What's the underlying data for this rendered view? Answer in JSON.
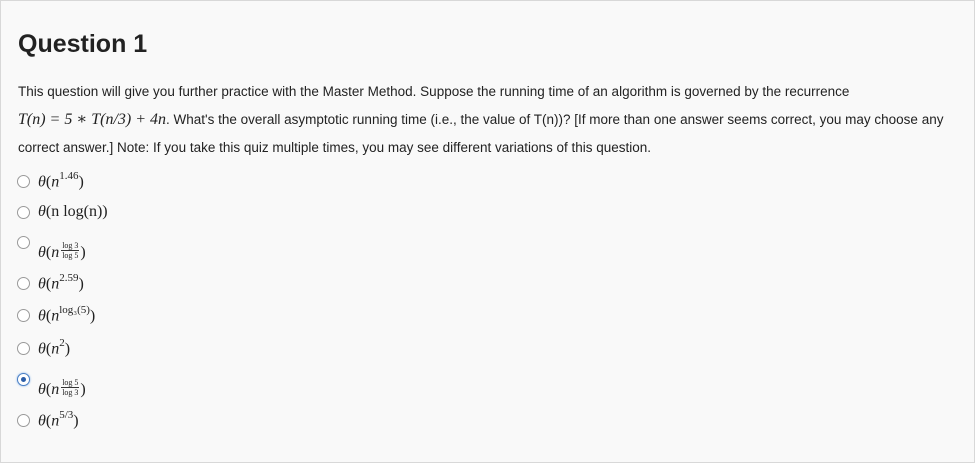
{
  "question": {
    "title": "Question 1",
    "text_part1": "This question will give you further practice with the Master Method. Suppose the running time of an algorithm is governed by the recurrence",
    "recurrence": "T(n) = 5 ∗ T(n/3) + 4n",
    "text_part2": ". What's the overall asymptotic running time (i.e., the value of T(n))? [If more than one answer seems correct, you may choose any correct answer.] Note: If you take this quiz multiple times, you may see different variations of this question."
  },
  "options": [
    {
      "theta": "θ",
      "base": "n",
      "exponent": "1.46",
      "checked": false
    },
    {
      "theta": "θ",
      "expr": "n log(n)",
      "checked": false
    },
    {
      "theta": "θ",
      "base": "n",
      "frac_num": "log 3",
      "frac_den": "log 5",
      "checked": false
    },
    {
      "theta": "θ",
      "base": "n",
      "exponent": "2.59",
      "checked": false
    },
    {
      "theta": "θ",
      "base": "n",
      "exponent": "log₃(5)",
      "checked": false
    },
    {
      "theta": "θ",
      "base": "n",
      "exponent": "2",
      "checked": false
    },
    {
      "theta": "θ",
      "base": "n",
      "frac_num": "log 5",
      "frac_den": "log 3",
      "checked": true
    },
    {
      "theta": "θ",
      "base": "n",
      "exponent": "5/3",
      "checked": false
    }
  ],
  "colors": {
    "background": "#f9f9f9",
    "border": "#d8d8d8",
    "radio_selected": "#2c5ea8",
    "text": "#222222"
  }
}
